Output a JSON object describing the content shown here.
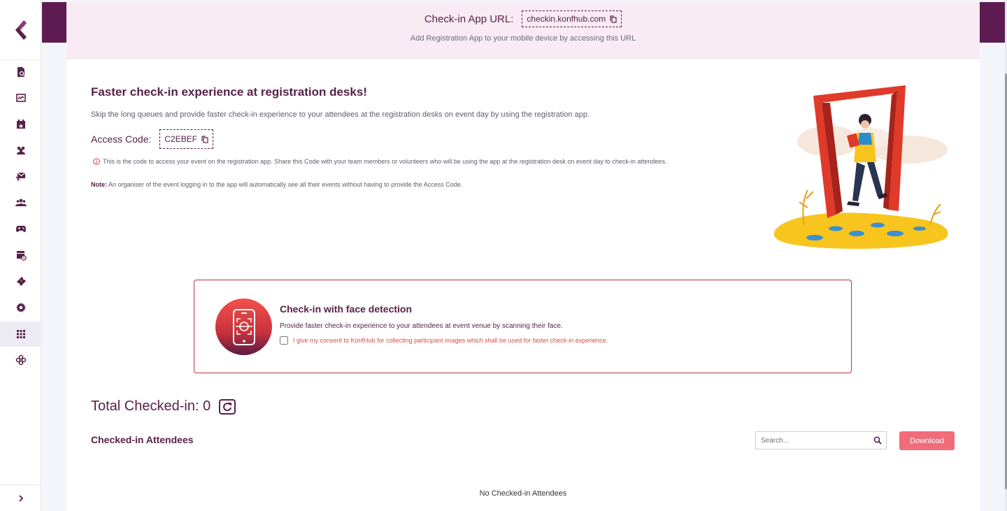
{
  "banner": {
    "url_label": "Check-in App URL:",
    "url_value": "checkin.konfhub.com",
    "subtitle": "Add Registration App to your mobile device by accessing this URL"
  },
  "intro": {
    "title": "Faster check-in experience at registration desks!",
    "description": "Skip the long queues and provide faster check-in experience to your attendees at the registration desks on event day by using the registration app.",
    "access_label": "Access Code:",
    "access_code": "C2EBEF",
    "info": "This is the code to access your event on the registration app. Share this Code with your team members or volunteers who will be using the app at the registration desk on event day to check-in attendees.",
    "note_label": "Note:",
    "note_text": "An organiser of the event logging in to the app will automatically see all their events without having to provide the Access Code."
  },
  "face_detection": {
    "title": "Check-in with face detection",
    "description": "Provide faster check-in experience to your attendees at event venue by scanning their face.",
    "consent": "I give my consent to KonfHub for collecting participant images which shall be used for faster check-in experience."
  },
  "checked_in": {
    "total_text": "Total Checked-in: 0",
    "section_title": "Checked-in Attendees",
    "search_placeholder": "Search...",
    "download_label": "Download",
    "empty_text": "No Checked-in Attendees"
  },
  "sidebar": {
    "items": [
      {
        "icon": "report-search-icon"
      },
      {
        "icon": "analytics-icon"
      },
      {
        "icon": "calendar-star-icon"
      },
      {
        "icon": "users-icon"
      },
      {
        "icon": "email-share-icon"
      },
      {
        "icon": "group-icon"
      },
      {
        "icon": "gamepad-icon"
      },
      {
        "icon": "calendar-clock-icon"
      },
      {
        "icon": "ticket-icon"
      },
      {
        "icon": "gear-icon"
      },
      {
        "icon": "apps-grid-icon"
      },
      {
        "icon": "integrations-icon"
      }
    ]
  },
  "colors": {
    "brand": "#572148",
    "accent": "#f26b7a",
    "banner_bg": "#f8ebf4",
    "consent_red": "#e04848"
  }
}
